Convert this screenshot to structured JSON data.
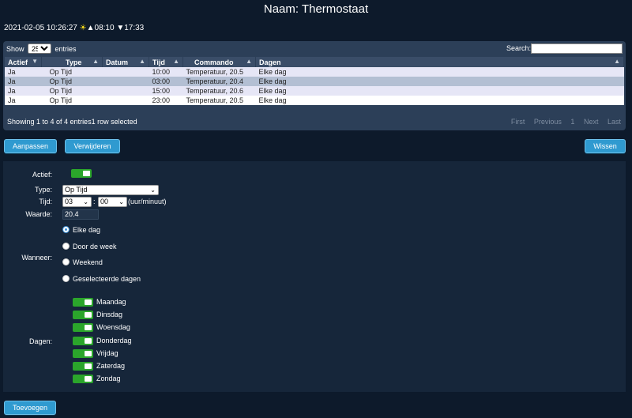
{
  "header": {
    "title": "Naam: Thermostaat"
  },
  "status": {
    "datetime": "2021-02-05 10:26:27",
    "sun_icon": "☀",
    "sunrise": "▲08:10",
    "sunset": "▼17:33"
  },
  "table": {
    "show_label": "Show",
    "page_size": "25",
    "entries_label": "entries",
    "search_label": "Search:",
    "search_value": "",
    "columns": [
      "Actief",
      "Type",
      "Datum",
      "Tijd",
      "Commando",
      "Dagen"
    ],
    "rows": [
      [
        "Ja",
        "Op Tijd",
        "",
        "10:00",
        "Temperatuur, 20.5",
        "Elke dag"
      ],
      [
        "Ja",
        "Op Tijd",
        "",
        "03:00",
        "Temperatuur, 20.4",
        "Elke dag"
      ],
      [
        "Ja",
        "Op Tijd",
        "",
        "15:00",
        "Temperatuur, 20.6",
        "Elke dag"
      ],
      [
        "Ja",
        "Op Tijd",
        "",
        "23:00",
        "Temperatuur, 20.5",
        "Elke dag"
      ]
    ],
    "info": "Showing 1 to 4 of 4 entries1 row selected",
    "pager": {
      "first": "First",
      "previous": "Previous",
      "page": "1",
      "next": "Next",
      "last": "Last"
    }
  },
  "buttons": {
    "edit": "Aanpassen",
    "delete": "Verwijderen",
    "clear": "Wissen",
    "add": "Toevoegen"
  },
  "form": {
    "active_label": "Actief:",
    "active": true,
    "type_label": "Type:",
    "type_value": "Op Tijd",
    "time_label": "Tijd:",
    "hour": "03",
    "separator": ":",
    "minute": "00",
    "time_hint": "(uur/minuut)",
    "value_label": "Waarde:",
    "value": "20.4",
    "when_label": "Wanneer:",
    "when_options": [
      "Elke dag",
      "Door de week",
      "Weekend",
      "Geselecteerde dagen"
    ],
    "when_selected": "Elke dag",
    "days_label": "Dagen:",
    "days": [
      "Maandag",
      "Dinsdag",
      "Woensdag",
      "Donderdag",
      "Vrijdag",
      "Zaterdag",
      "Zondag"
    ]
  },
  "colors": {
    "background": "#0d1a2b",
    "toggle_on": "#2ba52b",
    "button": "#2f9ad0",
    "selected_row": "#b3bfd3"
  }
}
